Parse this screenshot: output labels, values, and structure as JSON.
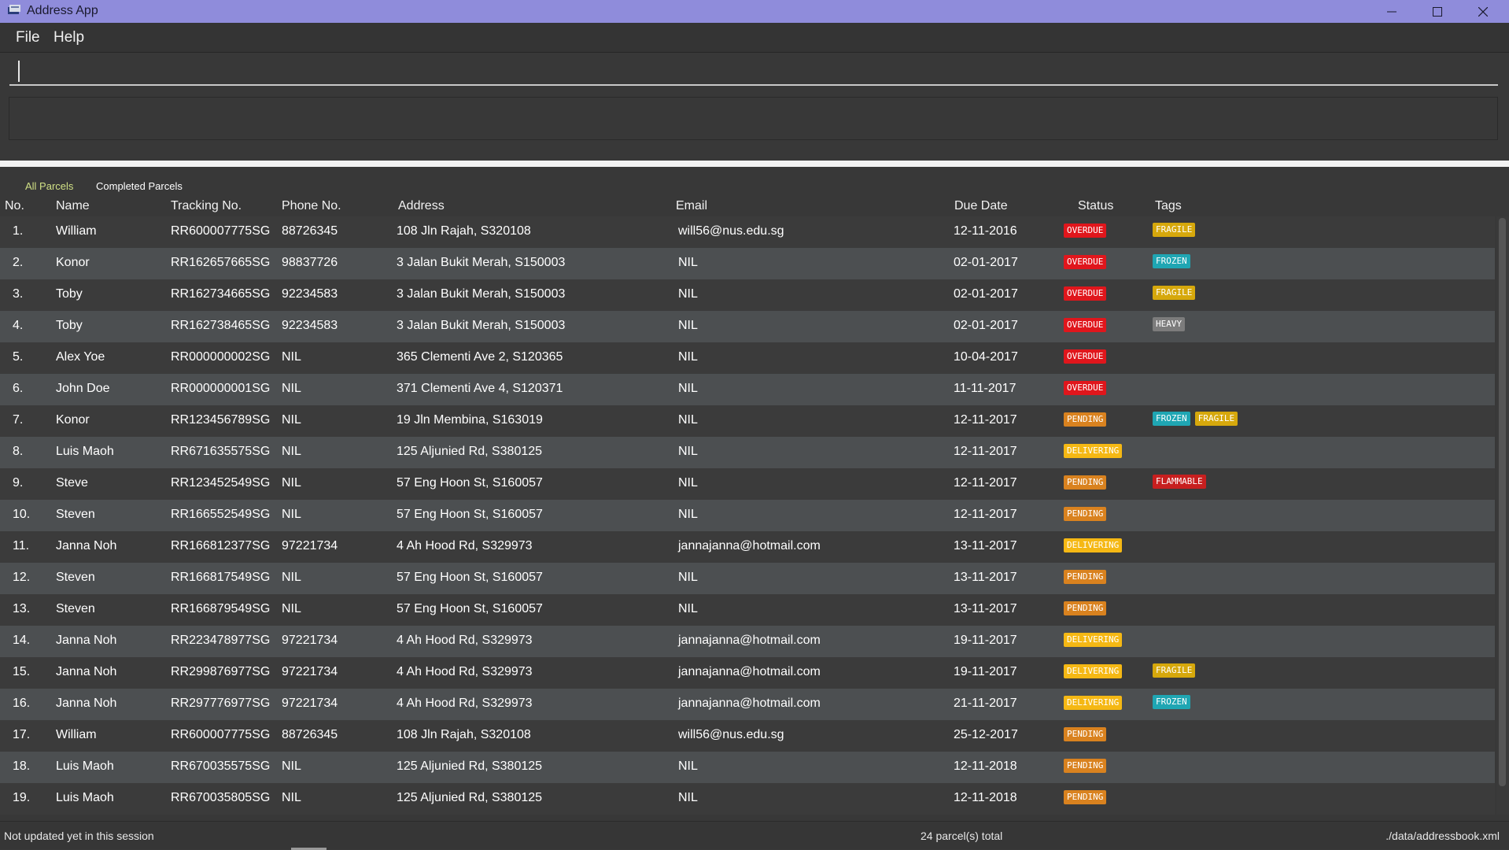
{
  "window": {
    "title": "Address App",
    "accent_color": "#8f8cdb"
  },
  "menu": {
    "file": "File",
    "help": "Help"
  },
  "command": {
    "value": "",
    "result": ""
  },
  "tabs": {
    "all": "All Parcels",
    "completed": "Completed Parcels"
  },
  "table": {
    "headers": {
      "no": "No.",
      "name": "Name",
      "tracking": "Tracking No.",
      "phone": "Phone No.",
      "address": "Address",
      "email": "Email",
      "due": "Due Date",
      "status": "Status",
      "tags": "Tags"
    },
    "rows": [
      {
        "no": "1.",
        "name": "William",
        "tracking": "RR600007775SG",
        "phone": "88726345",
        "address": "108 Jln Rajah, S320108",
        "email": "will56@nus.edu.sg",
        "due": "12-11-2016",
        "status": "OVERDUE",
        "tags": [
          "FRAGILE"
        ]
      },
      {
        "no": "2.",
        "name": "Konor",
        "tracking": "RR162657665SG",
        "phone": "98837726",
        "address": "3 Jalan Bukit Merah, S150003",
        "email": "NIL",
        "due": "02-01-2017",
        "status": "OVERDUE",
        "tags": [
          "FROZEN"
        ]
      },
      {
        "no": "3.",
        "name": "Toby",
        "tracking": "RR162734665SG",
        "phone": "92234583",
        "address": "3 Jalan Bukit Merah, S150003",
        "email": "NIL",
        "due": "02-01-2017",
        "status": "OVERDUE",
        "tags": [
          "FRAGILE"
        ]
      },
      {
        "no": "4.",
        "name": "Toby",
        "tracking": "RR162738465SG",
        "phone": "92234583",
        "address": "3 Jalan Bukit Merah, S150003",
        "email": "NIL",
        "due": "02-01-2017",
        "status": "OVERDUE",
        "tags": [
          "HEAVY"
        ]
      },
      {
        "no": "5.",
        "name": "Alex Yoe",
        "tracking": "RR000000002SG",
        "phone": "NIL",
        "address": "365 Clementi Ave 2, S120365",
        "email": "NIL",
        "due": "10-04-2017",
        "status": "OVERDUE",
        "tags": []
      },
      {
        "no": "6.",
        "name": "John Doe",
        "tracking": "RR000000001SG",
        "phone": "NIL",
        "address": "371 Clementi Ave 4, S120371",
        "email": "NIL",
        "due": "11-11-2017",
        "status": "OVERDUE",
        "tags": []
      },
      {
        "no": "7.",
        "name": "Konor",
        "tracking": "RR123456789SG",
        "phone": "NIL",
        "address": "19 Jln Membina, S163019",
        "email": "NIL",
        "due": "12-11-2017",
        "status": "PENDING",
        "tags": [
          "FROZEN",
          "FRAGILE"
        ]
      },
      {
        "no": "8.",
        "name": "Luis Maoh",
        "tracking": "RR671635575SG",
        "phone": "NIL",
        "address": "125 Aljunied Rd, S380125",
        "email": "NIL",
        "due": "12-11-2017",
        "status": "DELIVERING",
        "tags": []
      },
      {
        "no": "9.",
        "name": "Steve",
        "tracking": "RR123452549SG",
        "phone": "NIL",
        "address": "57 Eng Hoon St, S160057",
        "email": "NIL",
        "due": "12-11-2017",
        "status": "PENDING",
        "tags": [
          "FLAMMABLE"
        ]
      },
      {
        "no": "10.",
        "name": "Steven",
        "tracking": "RR166552549SG",
        "phone": "NIL",
        "address": "57 Eng Hoon St, S160057",
        "email": "NIL",
        "due": "12-11-2017",
        "status": "PENDING",
        "tags": []
      },
      {
        "no": "11.",
        "name": "Janna Noh",
        "tracking": "RR166812377SG",
        "phone": "97221734",
        "address": "4 Ah Hood Rd, S329973",
        "email": "jannajanna@hotmail.com",
        "due": "13-11-2017",
        "status": "DELIVERING",
        "tags": []
      },
      {
        "no": "12.",
        "name": "Steven",
        "tracking": "RR166817549SG",
        "phone": "NIL",
        "address": "57 Eng Hoon St, S160057",
        "email": "NIL",
        "due": "13-11-2017",
        "status": "PENDING",
        "tags": []
      },
      {
        "no": "13.",
        "name": "Steven",
        "tracking": "RR166879549SG",
        "phone": "NIL",
        "address": "57 Eng Hoon St, S160057",
        "email": "NIL",
        "due": "13-11-2017",
        "status": "PENDING",
        "tags": []
      },
      {
        "no": "14.",
        "name": "Janna Noh",
        "tracking": "RR223478977SG",
        "phone": "97221734",
        "address": "4 Ah Hood Rd, S329973",
        "email": "jannajanna@hotmail.com",
        "due": "19-11-2017",
        "status": "DELIVERING",
        "tags": []
      },
      {
        "no": "15.",
        "name": "Janna Noh",
        "tracking": "RR299876977SG",
        "phone": "97221734",
        "address": "4 Ah Hood Rd, S329973",
        "email": "jannajanna@hotmail.com",
        "due": "19-11-2017",
        "status": "DELIVERING",
        "tags": [
          "FRAGILE"
        ]
      },
      {
        "no": "16.",
        "name": "Janna Noh",
        "tracking": "RR297776977SG",
        "phone": "97221734",
        "address": "4 Ah Hood Rd, S329973",
        "email": "jannajanna@hotmail.com",
        "due": "21-11-2017",
        "status": "DELIVERING",
        "tags": [
          "FROZEN"
        ]
      },
      {
        "no": "17.",
        "name": "William",
        "tracking": "RR600007775SG",
        "phone": "88726345",
        "address": "108 Jln Rajah, S320108",
        "email": "will56@nus.edu.sg",
        "due": "25-12-2017",
        "status": "PENDING",
        "tags": []
      },
      {
        "no": "18.",
        "name": "Luis Maoh",
        "tracking": "RR670035575SG",
        "phone": "NIL",
        "address": "125 Aljunied Rd, S380125",
        "email": "NIL",
        "due": "12-11-2018",
        "status": "PENDING",
        "tags": []
      },
      {
        "no": "19.",
        "name": "Luis Maoh",
        "tracking": "RR670035805SG",
        "phone": "NIL",
        "address": "125 Aljunied Rd, S380125",
        "email": "NIL",
        "due": "12-11-2018",
        "status": "PENDING",
        "tags": []
      }
    ]
  },
  "status_colors": {
    "OVERDUE": "#e0161c",
    "PENDING": "#d9821f",
    "DELIVERING": "#f5b814"
  },
  "tag_colors": {
    "FRAGILE": "#d6a80c",
    "FROZEN": "#1fa6b3",
    "HEAVY": "#7c7c7c",
    "FLAMMABLE": "#c71f1f"
  },
  "statusbar": {
    "left": "Not updated yet in this session",
    "middle": "24 parcel(s) total",
    "right": "./data/addressbook.xml"
  }
}
